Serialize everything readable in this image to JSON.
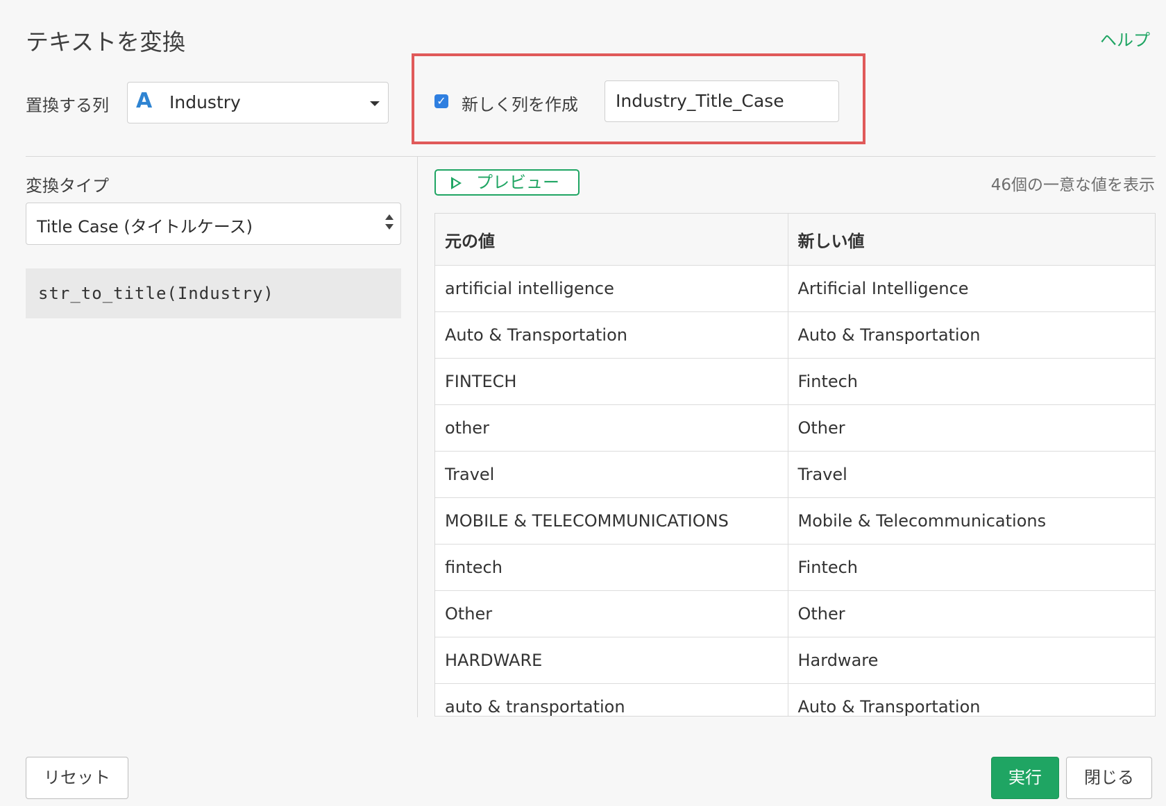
{
  "dialog": {
    "title": "テキストを変換",
    "help_link": "ヘルプ"
  },
  "column_select": {
    "label": "置換する列",
    "type_icon": "A",
    "value": "Industry"
  },
  "new_column": {
    "checkbox_checked": true,
    "label": "新しく列を作成",
    "value": "Industry_Title_Case"
  },
  "conversion": {
    "label": "変換タイプ",
    "selected": "Title Case (タイトルケース)",
    "code": "str_to_title(Industry)"
  },
  "preview": {
    "button_label": "プレビュー",
    "unique_count_text": "46個の一意な値を表示",
    "columns": [
      "元の値",
      "新しい値"
    ],
    "rows": [
      [
        "artificial intelligence",
        "Artificial Intelligence"
      ],
      [
        "Auto & Transportation",
        "Auto & Transportation"
      ],
      [
        "FINTECH",
        "Fintech"
      ],
      [
        "other",
        "Other"
      ],
      [
        "Travel",
        "Travel"
      ],
      [
        "MOBILE & TELECOMMUNICATIONS",
        "Mobile & Telecommunications"
      ],
      [
        "fintech",
        "Fintech"
      ],
      [
        "Other",
        "Other"
      ],
      [
        "HARDWARE",
        "Hardware"
      ],
      [
        "auto & transportation",
        "Auto & Transportation"
      ]
    ]
  },
  "footer": {
    "reset_label": "リセット",
    "run_label": "実行",
    "close_label": "閉じる"
  },
  "colors": {
    "accent_green": "#1fa563",
    "highlight_red": "#e05a5a",
    "checkbox_blue": "#2f7fe0",
    "type_icon_blue": "#2f84d2"
  }
}
